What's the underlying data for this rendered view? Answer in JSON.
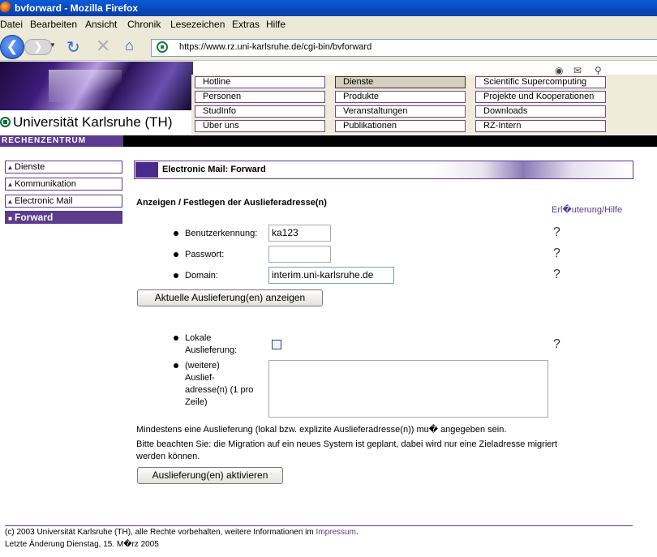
{
  "window": {
    "title": "bvforward - Mozilla Firefox"
  },
  "menu": {
    "items": [
      "Datei",
      "Bearbeiten",
      "Ansicht",
      "Chronik",
      "Lesezeichen",
      "Extras",
      "Hilfe"
    ]
  },
  "toolbar": {
    "url": "https://www.rz.uni-karlsruhe.de/cgi-bin/bvforward"
  },
  "header": {
    "university": "Universität Karlsruhe (TH)",
    "nav": [
      [
        "Hotline",
        "Dienste",
        "Scientific Supercomputing"
      ],
      [
        "Personen",
        "Produkte",
        "Projekte und  Kooperationen"
      ],
      [
        "StudInfo",
        "Veranstaltungen",
        "Downloads"
      ],
      [
        "Über uns",
        "Publikationen",
        "RZ-Intern"
      ]
    ],
    "rz_label": "RECHENZENTRUM"
  },
  "sidebar": {
    "items": [
      "Dienste",
      "Kommunikation",
      "Electronic Mail",
      "Forward"
    ]
  },
  "content": {
    "section_title": "Electronic Mail: Forward",
    "subtitle": "Anzeigen / Festlegen der Auslieferadresse(n)",
    "help_link": "Erl�uterung/Hilfe",
    "fields": {
      "user_label": "Benutzerkennung:",
      "user_value": "ka123",
      "password_label": "Passwort:",
      "password_value": "",
      "domain_label": "Domain:",
      "domain_value": "interim.uni-karlsruhe.de"
    },
    "show_button": "Aktuelle Auslieferung(en) anzeigen",
    "local_label_1": "Lokale",
    "local_label_2": "Auslieferung:",
    "further_label": [
      "(weitere)",
      "Auslief-",
      "adresse(n) (1 pro",
      "Zeile)"
    ],
    "note1": "Mindestens eine Auslieferung (lokal bzw. explizite Auslieferadresse(n)) mu� angegeben sein.",
    "note2": "Bitte beachten Sie: die Migration auf ein neues System ist geplant, dabei wird nur eine Zieladresse migriert",
    "note3": "werden können.",
    "activate_button": "Auslieferung(en) aktivieren",
    "help_icon": "?"
  },
  "footer": {
    "copyright": "(c) 2003 Universität Karlsruhe (TH), alle Rechte vorbehalten, weitere Informationen im ",
    "impressum": "Impressum",
    "period": ".",
    "last_change": "Letzte Änderung Dienstag, 15. M�rz 2005"
  }
}
